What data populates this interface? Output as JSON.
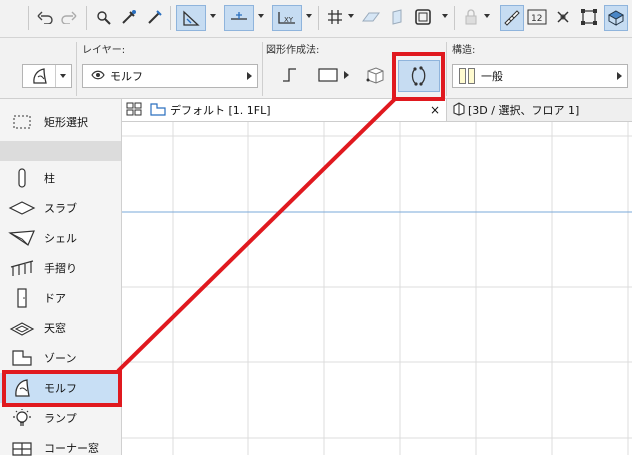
{
  "toolbar": {
    "icons": [
      "undo-icon",
      "redo-icon",
      "magic-wand-icon",
      "eyedropper-icon",
      "syringe-icon",
      "guide-lines-icon",
      "snap-icon",
      "xy-icon",
      "grid-snap-icon",
      "plane-icon",
      "slab-plane-icon",
      "outline-icon",
      "lock-icon",
      "ruler-scale-icon",
      "1-2-icon",
      "cross-icon",
      "selection-icon",
      "3d-box-icon"
    ],
    "scale_label": "1 2"
  },
  "infobox": {
    "layer_caption": "レイヤー:",
    "layer_value": "モルフ",
    "geometry_caption": "図形作成法:",
    "structure_caption": "構造:",
    "structure_value": "一般"
  },
  "tabs": {
    "floor_plan": "デフォルト [1. 1FL]",
    "close": "×",
    "view_3d": "[3D / 選択、フロア 1]"
  },
  "sidebar": {
    "items": [
      {
        "label": "矩形選択",
        "icon": "marquee-icon"
      },
      {
        "label": "柱",
        "icon": "column-icon"
      },
      {
        "label": "スラブ",
        "icon": "slab-icon"
      },
      {
        "label": "シェル",
        "icon": "shell-icon"
      },
      {
        "label": "手摺り",
        "icon": "railing-icon"
      },
      {
        "label": "ドア",
        "icon": "door-icon"
      },
      {
        "label": "天窓",
        "icon": "skylight-icon"
      },
      {
        "label": "ゾーン",
        "icon": "zone-icon"
      },
      {
        "label": "モルフ",
        "icon": "morph-icon",
        "selected": true
      },
      {
        "label": "ランプ",
        "icon": "lamp-icon"
      },
      {
        "label": "コーナー窓",
        "icon": "corner-window-icon"
      }
    ]
  },
  "colors": {
    "highlight": "#c8dff5",
    "annotation_red": "#e0191f",
    "grid_line": "#dcdcdc",
    "axis_line": "#7aa9d8"
  }
}
